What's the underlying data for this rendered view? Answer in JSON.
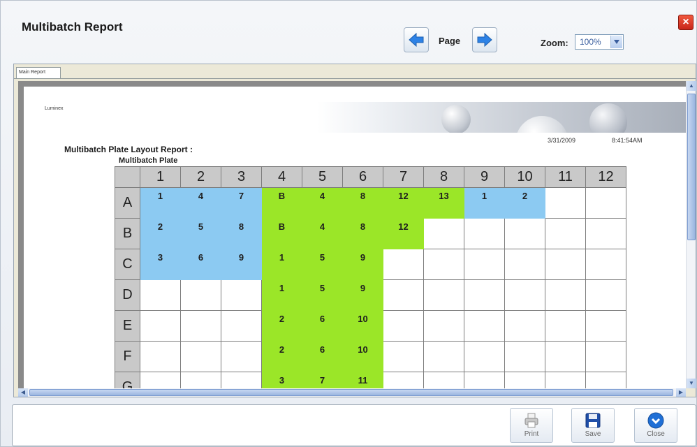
{
  "window": {
    "title": "Multibatch Report",
    "close_glyph": "×"
  },
  "toolbar": {
    "prev_icon": "arrow-left-icon",
    "next_icon": "arrow-right-icon",
    "page_label": "Page",
    "zoom_label": "Zoom:",
    "zoom_value": "100%"
  },
  "tabs": [
    {
      "label": "Main Report",
      "active": true
    }
  ],
  "report": {
    "brand": "Luminex",
    "date": "3/31/2009",
    "time": "8:41:54AM",
    "title": "Multibatch Plate Layout Report :",
    "subtitle": "Multibatch Plate",
    "plate": {
      "columns": [
        "1",
        "2",
        "3",
        "4",
        "5",
        "6",
        "7",
        "8",
        "9",
        "10",
        "11",
        "12"
      ],
      "rows": [
        {
          "label": "A",
          "cells": [
            [
              "1",
              "b"
            ],
            [
              "4",
              "b"
            ],
            [
              "7",
              "b"
            ],
            [
              "B",
              "g"
            ],
            [
              "4",
              "g"
            ],
            [
              "8",
              "g"
            ],
            [
              "12",
              "g"
            ],
            [
              "13",
              "g"
            ],
            [
              "1",
              "b"
            ],
            [
              "2",
              "b"
            ],
            [
              "",
              "w"
            ],
            [
              "",
              "w"
            ]
          ]
        },
        {
          "label": "B",
          "cells": [
            [
              "2",
              "b"
            ],
            [
              "5",
              "b"
            ],
            [
              "8",
              "b"
            ],
            [
              "B",
              "g"
            ],
            [
              "4",
              "g"
            ],
            [
              "8",
              "g"
            ],
            [
              "12",
              "g"
            ],
            [
              "",
              "w"
            ],
            [
              "",
              "w"
            ],
            [
              "",
              "w"
            ],
            [
              "",
              "w"
            ],
            [
              "",
              "w"
            ]
          ]
        },
        {
          "label": "C",
          "cells": [
            [
              "3",
              "b"
            ],
            [
              "6",
              "b"
            ],
            [
              "9",
              "b"
            ],
            [
              "1",
              "g"
            ],
            [
              "5",
              "g"
            ],
            [
              "9",
              "g"
            ],
            [
              "",
              "w"
            ],
            [
              "",
              "w"
            ],
            [
              "",
              "w"
            ],
            [
              "",
              "w"
            ],
            [
              "",
              "w"
            ],
            [
              "",
              "w"
            ]
          ]
        },
        {
          "label": "D",
          "cells": [
            [
              "",
              "w"
            ],
            [
              "",
              "w"
            ],
            [
              "",
              "w"
            ],
            [
              "1",
              "g"
            ],
            [
              "5",
              "g"
            ],
            [
              "9",
              "g"
            ],
            [
              "",
              "w"
            ],
            [
              "",
              "w"
            ],
            [
              "",
              "w"
            ],
            [
              "",
              "w"
            ],
            [
              "",
              "w"
            ],
            [
              "",
              "w"
            ]
          ]
        },
        {
          "label": "E",
          "cells": [
            [
              "",
              "w"
            ],
            [
              "",
              "w"
            ],
            [
              "",
              "w"
            ],
            [
              "2",
              "g"
            ],
            [
              "6",
              "g"
            ],
            [
              "10",
              "g"
            ],
            [
              "",
              "w"
            ],
            [
              "",
              "w"
            ],
            [
              "",
              "w"
            ],
            [
              "",
              "w"
            ],
            [
              "",
              "w"
            ],
            [
              "",
              "w"
            ]
          ]
        },
        {
          "label": "F",
          "cells": [
            [
              "",
              "w"
            ],
            [
              "",
              "w"
            ],
            [
              "",
              "w"
            ],
            [
              "2",
              "g"
            ],
            [
              "6",
              "g"
            ],
            [
              "10",
              "g"
            ],
            [
              "",
              "w"
            ],
            [
              "",
              "w"
            ],
            [
              "",
              "w"
            ],
            [
              "",
              "w"
            ],
            [
              "",
              "w"
            ],
            [
              "",
              "w"
            ]
          ]
        },
        {
          "label": "G",
          "cells": [
            [
              "",
              "w"
            ],
            [
              "",
              "w"
            ],
            [
              "",
              "w"
            ],
            [
              "3",
              "g"
            ],
            [
              "7",
              "g"
            ],
            [
              "11",
              "g"
            ],
            [
              "",
              "w"
            ],
            [
              "",
              "w"
            ],
            [
              "",
              "w"
            ],
            [
              "",
              "w"
            ],
            [
              "",
              "w"
            ],
            [
              "",
              "w"
            ]
          ]
        }
      ]
    }
  },
  "colors": {
    "blue_well": "#8ccaf2",
    "green_well": "#9be628",
    "header_gray": "#c9c9c9"
  },
  "actions": {
    "print_label": "Print",
    "save_label": "Save",
    "close_label": "Close"
  }
}
